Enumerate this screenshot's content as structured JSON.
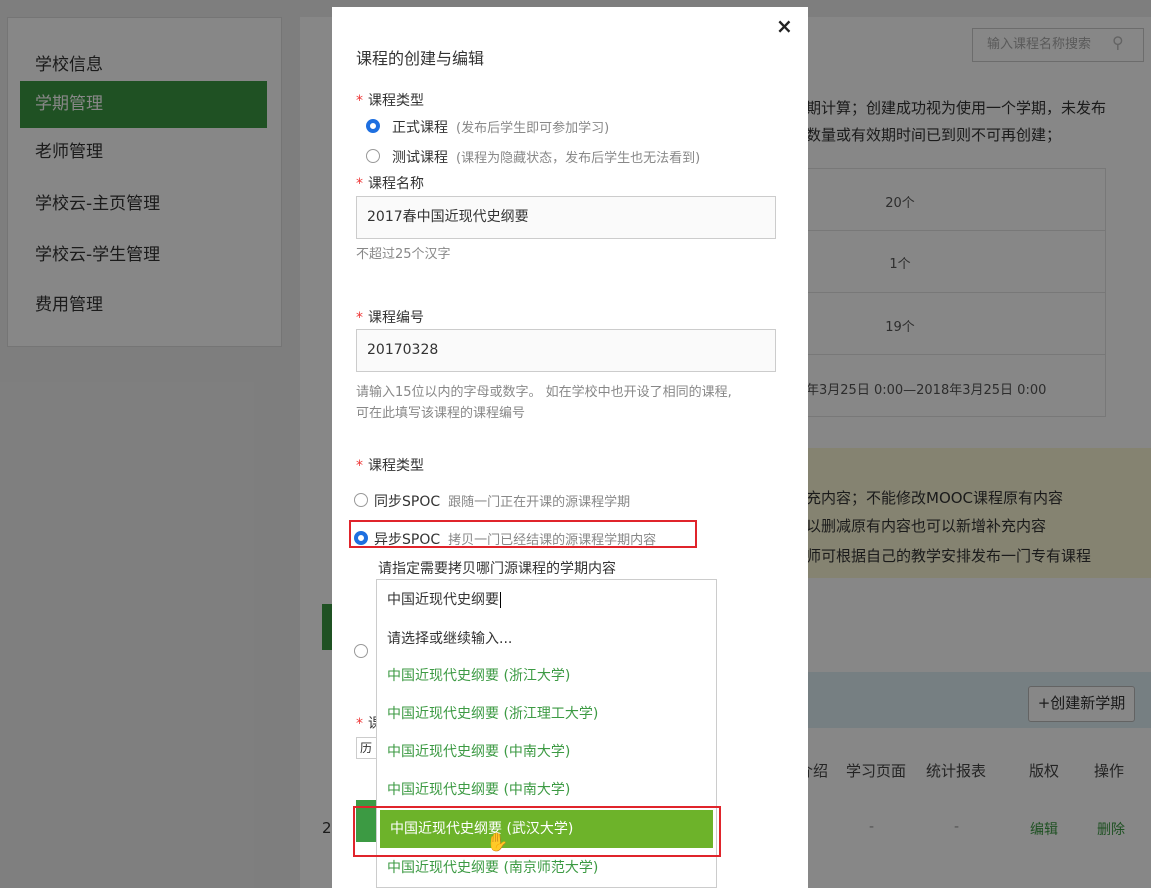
{
  "sidebar": {
    "items": [
      {
        "label": "学校信息",
        "active": false
      },
      {
        "label": "学期管理",
        "active": true
      },
      {
        "label": "老师管理",
        "active": false
      },
      {
        "label": "学校云-主页管理",
        "active": false
      },
      {
        "label": "学校云-学生管理",
        "active": false
      },
      {
        "label": "费用管理",
        "active": false
      }
    ]
  },
  "background": {
    "search_placeholder": "输入课程名称搜索",
    "notice_line1": "期计算；创建成功视为使用一个学期，未发布",
    "notice_line2": "数量或有效期时间已到则不可再创建；",
    "table_values": [
      "20个",
      "1个",
      "19个",
      "年3月25日 0:00—2018年3月25日 0:00"
    ],
    "info_lines": [
      "充内容；不能修改MOOC课程原有内容",
      "以删减原有内容也可以新增补充内容",
      "师可根据自己的教学安排发布一门专有课程"
    ],
    "create_term_button": "+创建新学期",
    "columns": [
      "介绍",
      "学习页面",
      "统计报表",
      "版权",
      "操作"
    ],
    "row": {
      "dash1": "-",
      "dash2": "-",
      "edit": "编辑",
      "delete": "删除",
      "index": "2"
    }
  },
  "modal": {
    "title": "课程的创建与编辑",
    "close": "×",
    "course_type_label": "课程类型",
    "type_options": [
      {
        "label": "正式课程",
        "note": "(发布后学生即可参加学习)",
        "selected": true
      },
      {
        "label": "测试课程",
        "note": "(课程为隐藏状态，发布后学生也无法看到)",
        "selected": false
      }
    ],
    "name_label": "课程名称",
    "name_value": "2017春中国近现代史纲要",
    "name_hint": "不超过25个汉字",
    "code_label": "课程编号",
    "code_value": "20170328",
    "code_hint_line1": "请输入15位以内的字母或数字。 如在学校中也开设了相同的课程,",
    "code_hint_line2": "可在此填写该课程的课程编号",
    "spoc_type_label": "课程类型",
    "spoc_options": [
      {
        "label": "同步SPOC",
        "note": "跟随一门正在开课的源课程学期",
        "selected": false
      },
      {
        "label": "异步SPOC",
        "note": "拷贝一门已经结课的源课程学期内容",
        "selected": true
      }
    ],
    "source_prompt": "请指定需要拷贝哪门源课程的学期内容",
    "source_input_value": "中国近现代史纲要",
    "dropdown_placeholder": "请选择或继续输入...",
    "dropdown_items": [
      "中国近现代史纲要 (浙江大学)",
      "中国近现代史纲要 (浙江理工大学)",
      "中国近现代史纲要 (中南大学)",
      "中国近现代史纲要 (中南大学)",
      "中国近现代史纲要 (武汉大学)",
      "中国近现代史纲要 (南京师范大学)"
    ],
    "highlighted_index": 4,
    "hidden_label_fragment": "课",
    "hidden_select_fragment": "历"
  },
  "colors": {
    "accent_green": "#3c9a43",
    "highlight_green": "#6db32a",
    "annotation_red": "#e0242b",
    "radio_blue": "#1e6fe0"
  }
}
